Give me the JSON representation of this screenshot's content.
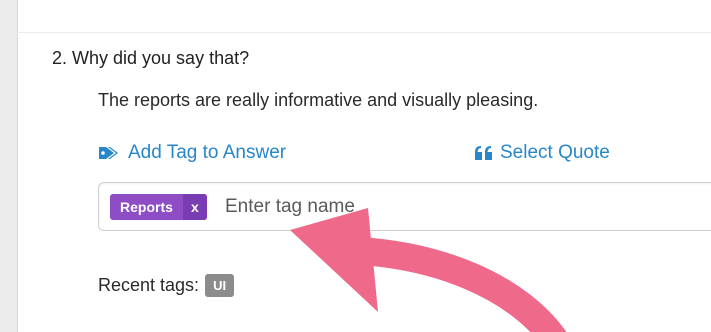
{
  "question": {
    "text": "2. Why did you say that?"
  },
  "answer": {
    "text": "The reports are really informative and visually pleasing."
  },
  "actions": {
    "add_tag_label": "Add Tag to Answer",
    "select_quote_label": "Select Quote"
  },
  "tag_input": {
    "chips": [
      {
        "label": "Reports",
        "remove": "x"
      }
    ],
    "placeholder": "Enter tag name"
  },
  "recent_tags": {
    "label": "Recent tags:",
    "tags": [
      "UI"
    ]
  },
  "colors": {
    "link": "#2787c9",
    "chip": "#8e4cc5",
    "recent_tag": "#8c8c8c",
    "annotation_arrow": "#ef6a8a"
  },
  "icons": {
    "add_tag": "tags-icon",
    "select_quote": "quote-left-icon",
    "annotation": "curved-arrow-icon"
  }
}
